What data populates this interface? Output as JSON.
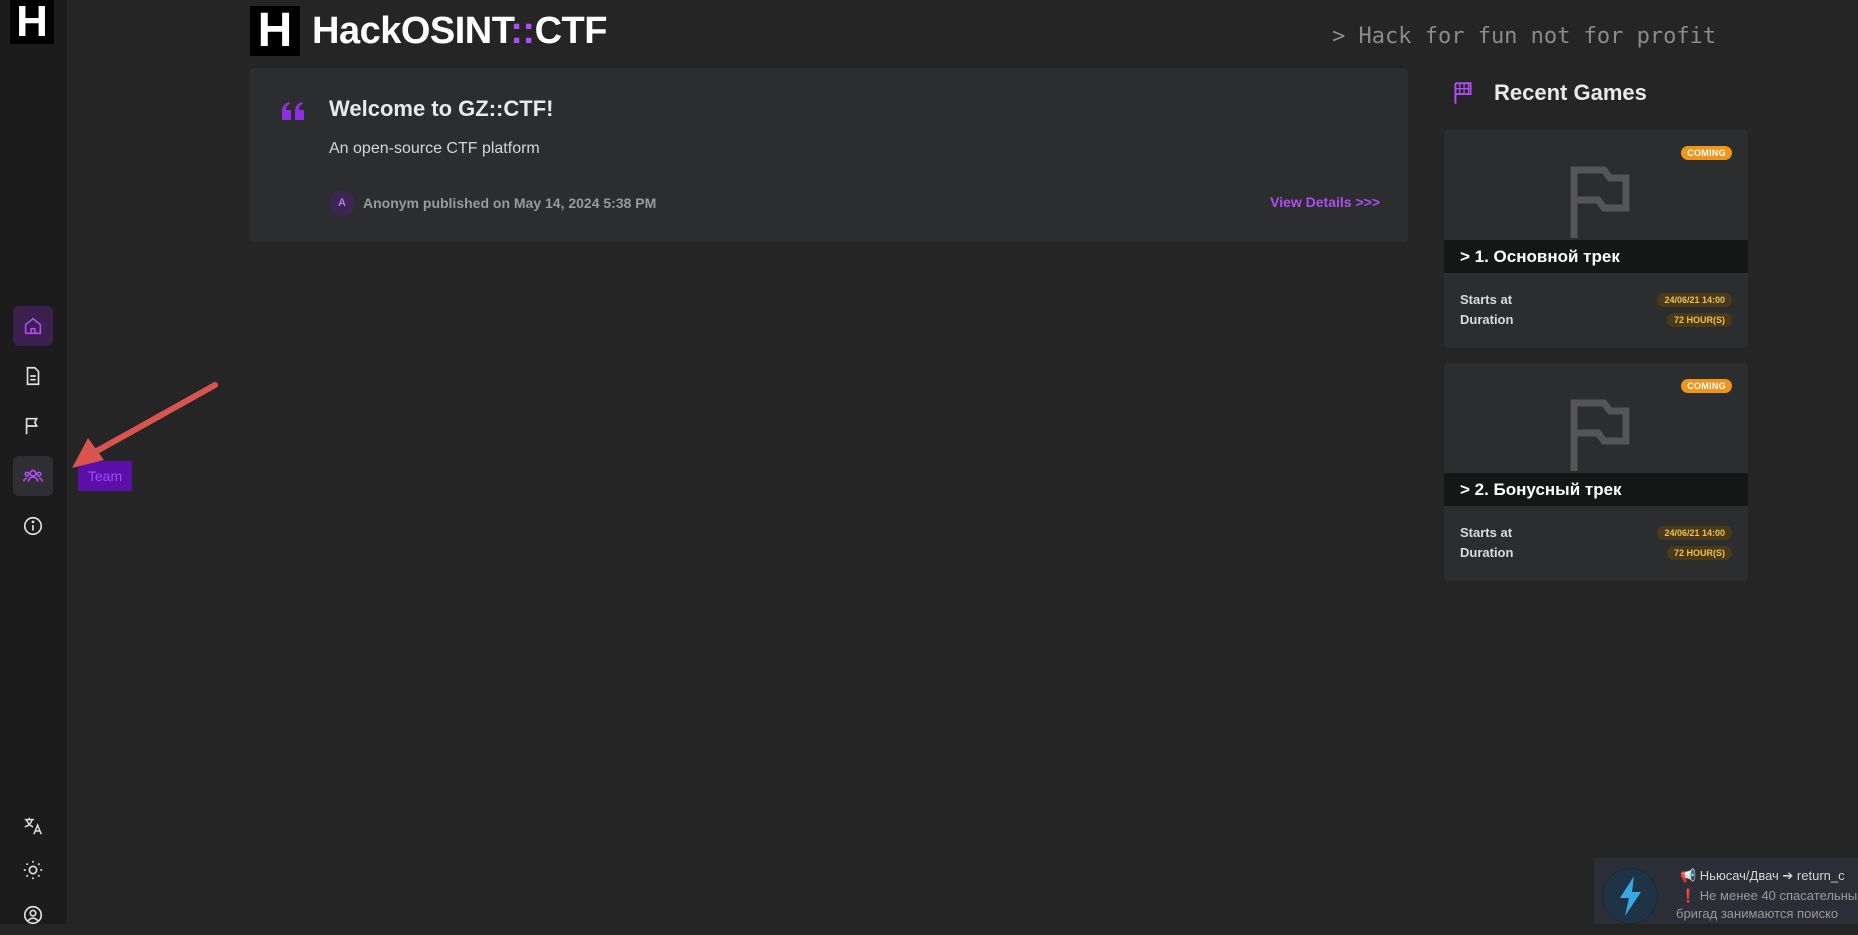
{
  "sidebar": {
    "logo": "H",
    "tooltip": "Team",
    "icons": [
      "home-icon",
      "posts-icon",
      "flag-icon",
      "team-icon",
      "info-icon",
      "translate-icon",
      "theme-icon",
      "user-icon"
    ]
  },
  "header": {
    "logo": "H",
    "brand_main": "HackOSINT",
    "brand_sep": "::",
    "brand_tail": "CTF",
    "slogan": "> Hack for fun not for profit"
  },
  "post": {
    "title": "Welcome to GZ::CTF!",
    "subtitle": "An open-source CTF platform",
    "avatar": "A",
    "meta": "Anonym published on May 14, 2024 5:38 PM",
    "link": "View Details >>>"
  },
  "recent": {
    "title": "Recent Games",
    "games": [
      {
        "badge": "COMING",
        "name": "> 1. Основной трек",
        "starts_label": "Starts at",
        "starts_value": "24/06/21 14:00",
        "duration_label": "Duration",
        "duration_value": "72 HOUR(S)"
      },
      {
        "badge": "COMING",
        "name": "> 2. Бонусный трек",
        "starts_label": "Starts at",
        "starts_value": "24/06/21 14:00",
        "duration_label": "Duration",
        "duration_value": "72 HOUR(S)"
      }
    ]
  },
  "ticker": {
    "line1": "📢 Ньюсач/Двач ➔ return_c",
    "line2": "❗ Не менее 40 спасательны",
    "line3": "бригад занимаются поиско"
  },
  "colors": {
    "accent": "#b14cf5",
    "background": "#252525",
    "sidebar": "#1c1c1c",
    "card": "#2c2d2e",
    "badge": "#f0941a"
  }
}
